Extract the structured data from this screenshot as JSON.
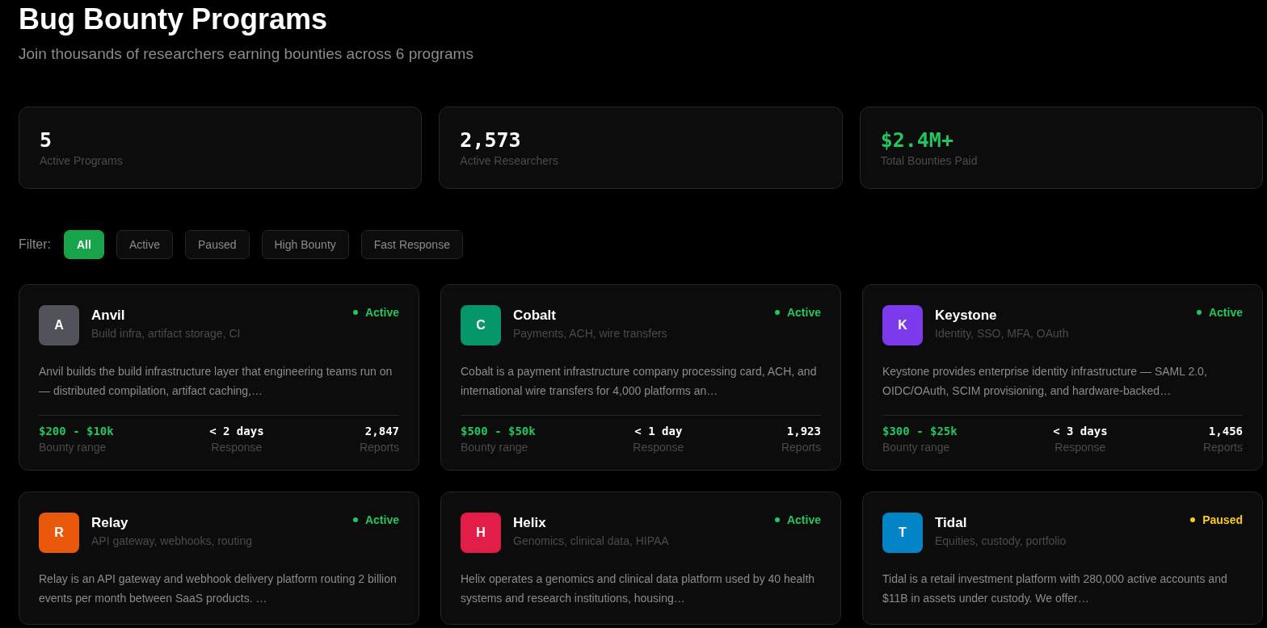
{
  "header": {
    "title": "Bug Bounty Programs",
    "subtitle": "Join thousands of researchers earning bounties across 6 programs"
  },
  "stats": [
    {
      "value": "5",
      "label": "Active Programs",
      "kind": "plain"
    },
    {
      "value": "2,573",
      "label": "Active Researchers",
      "kind": "plain"
    },
    {
      "value": "$2.4M+",
      "label": "Total Bounties Paid",
      "kind": "money"
    }
  ],
  "filter": {
    "label": "Filter:",
    "options": [
      {
        "label": "All",
        "selected": true
      },
      {
        "label": "Active",
        "selected": false
      },
      {
        "label": "Paused",
        "selected": false
      },
      {
        "label": "High Bounty",
        "selected": false
      },
      {
        "label": "Fast Response",
        "selected": false
      }
    ]
  },
  "programs": [
    {
      "initial": "A",
      "color": "#52525b",
      "name": "Anvil",
      "tags": "Build infra, artifact storage, CI",
      "status": {
        "kind": "active",
        "label": "Active"
      },
      "description": "Anvil builds the build infrastructure layer that engineering teams run on — distributed compilation, artifact caching,…",
      "metrics": [
        {
          "value": "$200 - $10k",
          "label": "Bounty range"
        },
        {
          "value": "< 2 days",
          "label": "Response"
        },
        {
          "value": "2,847",
          "label": "Reports"
        }
      ]
    },
    {
      "initial": "C",
      "color": "#059669",
      "name": "Cobalt",
      "tags": "Payments, ACH, wire transfers",
      "status": {
        "kind": "active",
        "label": "Active"
      },
      "description": "Cobalt is a payment infrastructure company processing card, ACH, and international wire transfers for 4,000 platforms an…",
      "metrics": [
        {
          "value": "$500 - $50k",
          "label": "Bounty range"
        },
        {
          "value": "< 1 day",
          "label": "Response"
        },
        {
          "value": "1,923",
          "label": "Reports"
        }
      ]
    },
    {
      "initial": "K",
      "color": "#7c3aed",
      "name": "Keystone",
      "tags": "Identity, SSO, MFA, OAuth",
      "status": {
        "kind": "active",
        "label": "Active"
      },
      "description": "Keystone provides enterprise identity infrastructure — SAML 2.0, OIDC/OAuth, SCIM provisioning, and hardware-backed…",
      "metrics": [
        {
          "value": "$300 - $25k",
          "label": "Bounty range"
        },
        {
          "value": "< 3 days",
          "label": "Response"
        },
        {
          "value": "1,456",
          "label": "Reports"
        }
      ]
    },
    {
      "initial": "R",
      "color": "#ea580c",
      "name": "Relay",
      "tags": "API gateway, webhooks, routing",
      "status": {
        "kind": "active",
        "label": "Active"
      },
      "description": "Relay is an API gateway and webhook delivery platform routing 2 billion events per month between SaaS products. …"
    },
    {
      "initial": "H",
      "color": "#e11d48",
      "name": "Helix",
      "tags": "Genomics, clinical data, HIPAA",
      "status": {
        "kind": "active",
        "label": "Active"
      },
      "description": "Helix operates a genomics and clinical data platform used by 40 health systems and research institutions, housing…"
    },
    {
      "initial": "T",
      "color": "#0284c7",
      "name": "Tidal",
      "tags": "Equities, custody, portfolio",
      "status": {
        "kind": "paused",
        "label": "Paused"
      },
      "description": "Tidal is a retail investment platform with 280,000 active accounts and $11B in assets under custody. We offer…"
    }
  ]
}
